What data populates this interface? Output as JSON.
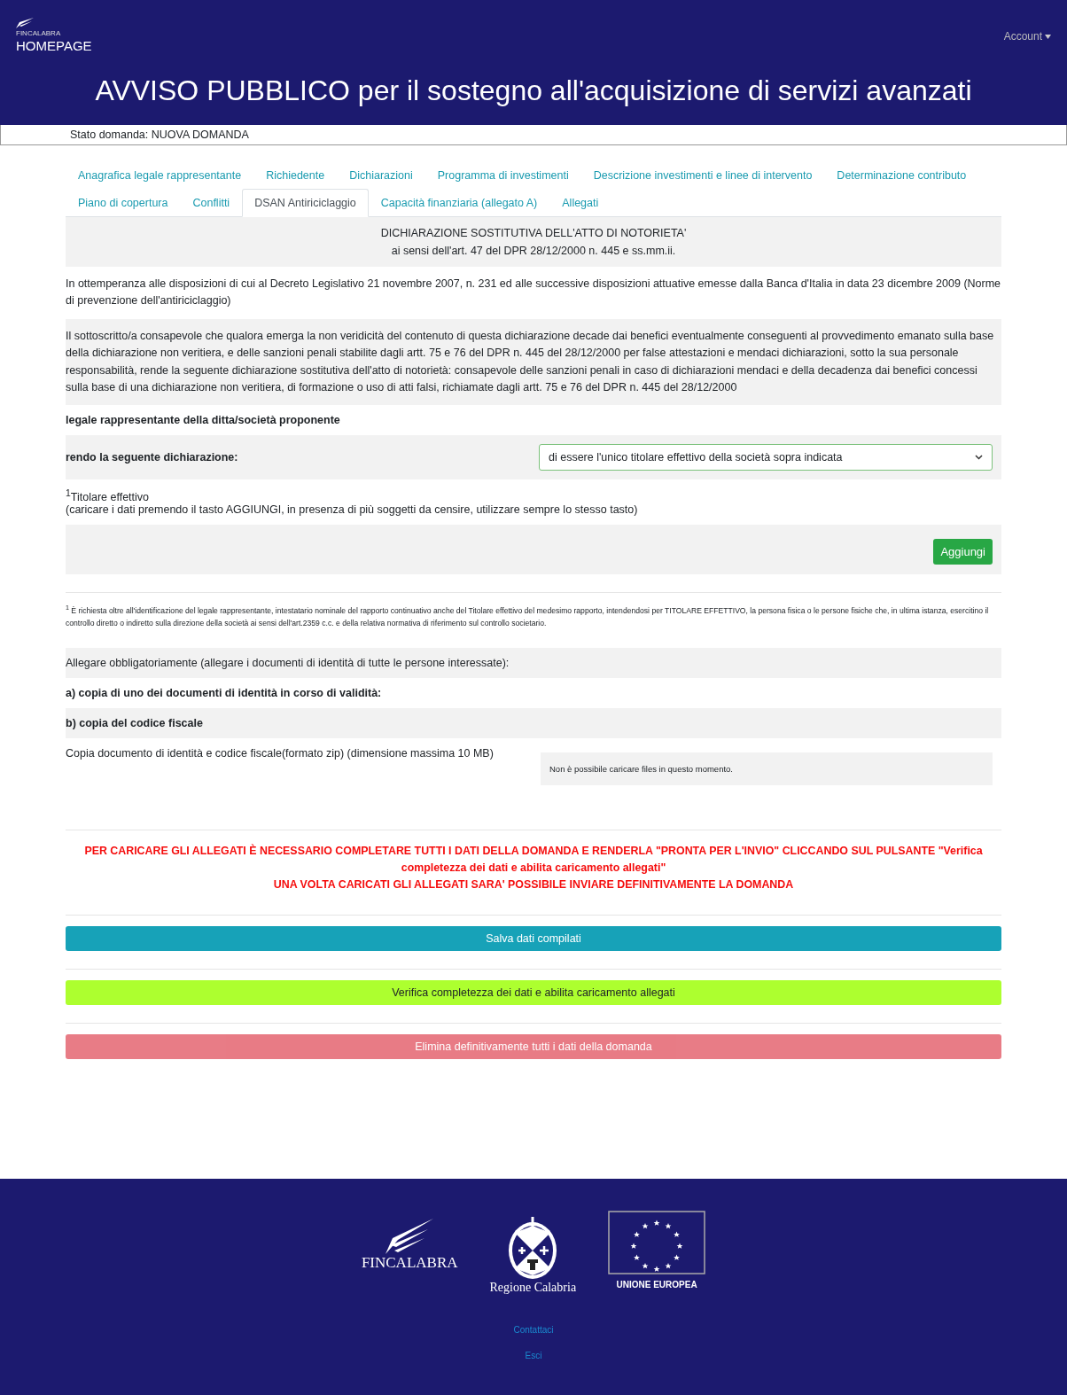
{
  "header": {
    "logo_text": "FINCALABRA",
    "home_link": "HOMEPAGE",
    "account": "Account",
    "title": "AVVISO PUBBLICO per il sostegno all'acquisizione di servizi avanzati"
  },
  "status": "Stato domanda: NUOVA DOMANDA",
  "tabs": [
    {
      "label": "Anagrafica legale rappresentante",
      "selected": false
    },
    {
      "label": "Richiedente",
      "selected": false
    },
    {
      "label": "Dichiarazioni",
      "selected": false
    },
    {
      "label": "Programma di investimenti",
      "selected": false
    },
    {
      "label": "Descrizione investimenti e linee di intervento",
      "selected": false
    },
    {
      "label": "Determinazione contributo",
      "selected": false
    },
    {
      "label": "Piano di copertura",
      "selected": false
    },
    {
      "label": "Conflitti",
      "selected": false
    },
    {
      "label": "DSAN Antiriciclaggio",
      "selected": true
    },
    {
      "label": "Capacità finanziaria (allegato A)",
      "selected": false
    },
    {
      "label": "Allegati",
      "selected": false
    }
  ],
  "form": {
    "heading": [
      "DICHIARAZIONE SOSTITUTIVA DELL'ATTO DI NOTORIETA'",
      "ai sensi dell'art. 47 del DPR 28/12/2000 n. 445 e ss.mm.ii."
    ],
    "intro": "In ottemperanza alle disposizioni di cui al Decreto Legislativo 21 novembre 2007, n. 231 ed alle successive disposizioni attuative emesse dalla Banca d'Italia in data 23 dicembre 2009 (Norme di prevenzione dell'antiriciclaggio)",
    "declaration": "Il sottoscritto/a consapevole che qualora emerga la non veridicità del contenuto di questa dichiarazione decade dai benefici eventualmente conseguenti al provvedimento emanato sulla base della dichiarazione non veritiera, e delle sanzioni penali stabilite dagli artt. 75 e 76 del DPR n. 445 del 28/12/2000 per false attestazioni e mendaci dichiarazioni, sotto la sua personale responsabilità, rende la seguente dichiarazione sostitutiva dell'atto di notorietà: consapevole delle sanzioni penali in caso di dichiarazioni mendaci e della decadenza dai benefici concessi sulla base di una dichiarazione non veritiera, di formazione o uso di atti falsi, richiamate dagli artt. 75 e 76 del DPR n. 445 del 28/12/2000",
    "legal_rep": "legale rappresentante della ditta/società proponente",
    "select": {
      "label": "rendo la seguente dichiarazione:",
      "value": "di essere l'unico titolare effettivo della società sopra indicata"
    },
    "titolare": {
      "title": "$^{1}$Titolare effettivo",
      "note": "(caricare i dati premendo il tasto AGGIUNGI, in presenza di più soggetti da censire, utilizzare sempre lo stesso tasto)"
    },
    "add_button": "Aggiungi",
    "footnote": "$^{1}$ È richiesta oltre all'identificazione del legale rappresentante, intestatario nominale del rapporto continuativo anche del Titolare effettivo del medesimo rapporto, intendendosi per TITOLARE EFFETTIVO, la persona fisica o le persone fisiche che, in ultima istanza, esercitino il controllo diretto o indiretto sulla direzione della società ai sensi dell'art.2359 c.c. e della relativa normativa di riferimento sul controllo societario.",
    "attach_intro": "Allegare obbligatoriamente (allegare i documenti di identità di tutte le persone interessate):",
    "attach_items": [
      "a) copia di uno dei documenti di identità in corso di validità:",
      "b) copia del codice fiscale"
    ],
    "upload": {
      "label": "Copia documento di identità e codice fiscale(formato zip) (dimensione massima 10 MB)",
      "message": "Non è possibile caricare files in questo momento."
    }
  },
  "notice": [
    "PER CARICARE GLI ALLEGATI È NECESSARIO COMPLETARE TUTTI I DATI DELLA DOMANDA E RENDERLA \"PRONTA PER L'INVIO\" CLICCANDO SUL PULSANTE \"Verifica completezza dei dati e abilita caricamento allegati\"",
    "UNA VOLTA CARICATI GLI ALLEGATI SARA' POSSIBILE INVIARE DEFINITIVAMENTE LA DOMANDA"
  ],
  "buttons": [
    {
      "label": "Salva dati compilati",
      "kind": "save",
      "disabled": false
    },
    {
      "label": "Verifica completezza dei dati e abilita caricamento allegati",
      "kind": "verify",
      "disabled": false
    },
    {
      "label": "Elimina definitivamente tutti i dati della domanda",
      "kind": "delete",
      "disabled": true
    }
  ],
  "footer": {
    "fincalabra": "FINCALABRA",
    "region": "Regione Calabria",
    "eu": "UNIONE EUROPEA",
    "links": [
      "Contattaci",
      "Esci"
    ]
  }
}
